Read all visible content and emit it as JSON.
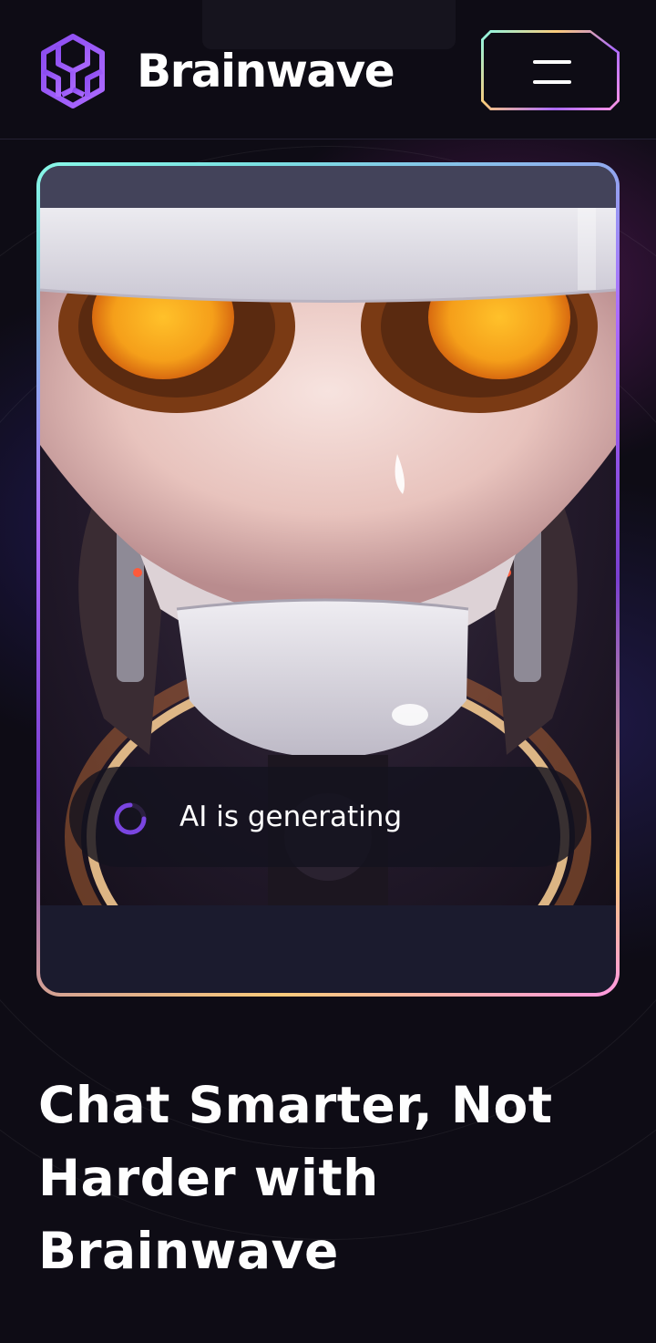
{
  "header": {
    "brand": "Brainwave",
    "logo_icon": "brainwave-logo-icon",
    "menu_icon": "hamburger-menu-icon"
  },
  "hero": {
    "image": "robot-head-illustration",
    "status_text": "AI is generating",
    "status_icon": "loading-spinner-icon"
  },
  "headline": {
    "line1": "Chat Smarter, Not",
    "line2": "Harder with Brainwave"
  },
  "colors": {
    "background": "#0e0c15",
    "accent_purple": "#ac6aff",
    "accent_cyan": "#89f9e8",
    "accent_yellow": "#facb7b",
    "accent_pink": "#ff98e2",
    "text": "#fefefe"
  }
}
